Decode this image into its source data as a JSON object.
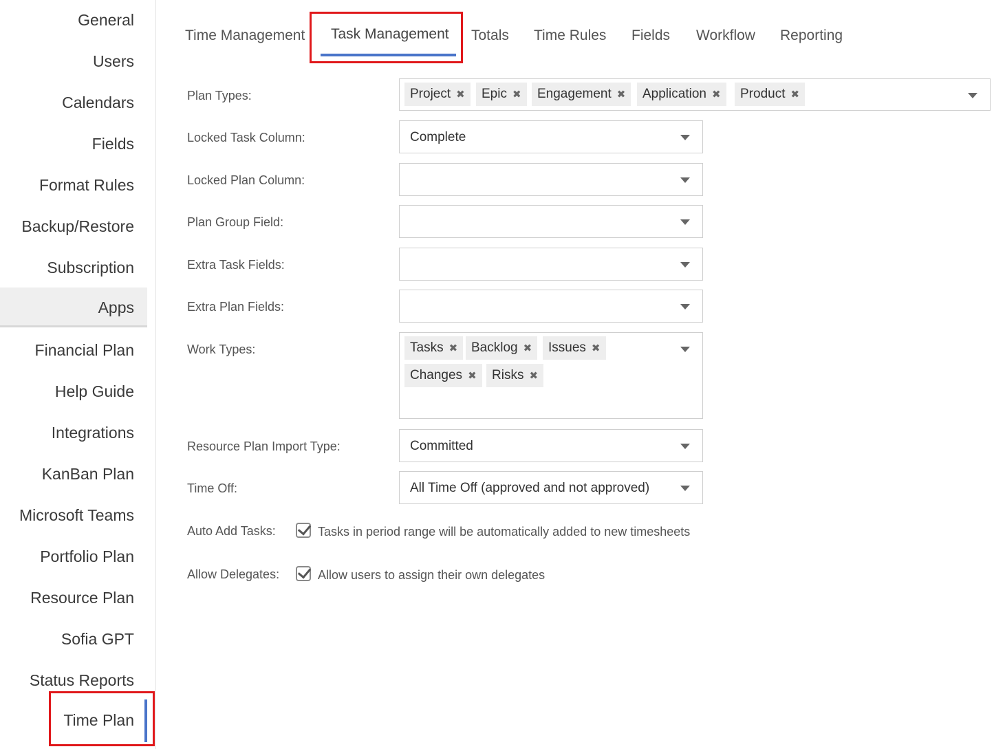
{
  "sidebar": {
    "items": [
      {
        "label": "General"
      },
      {
        "label": "Users"
      },
      {
        "label": "Calendars"
      },
      {
        "label": "Fields"
      },
      {
        "label": "Format Rules"
      },
      {
        "label": "Backup/Restore"
      },
      {
        "label": "Subscription"
      },
      {
        "label": "Apps"
      },
      {
        "label": "Financial Plan"
      },
      {
        "label": "Help Guide"
      },
      {
        "label": "Integrations"
      },
      {
        "label": "KanBan Plan"
      },
      {
        "label": "Microsoft Teams"
      },
      {
        "label": "Portfolio Plan"
      },
      {
        "label": "Resource Plan"
      },
      {
        "label": "Sofia GPT"
      },
      {
        "label": "Status Reports"
      },
      {
        "label": "Time Plan"
      }
    ],
    "active": "Time Plan"
  },
  "tabs": [
    {
      "label": "Time Management"
    },
    {
      "label": "Task Management"
    },
    {
      "label": "Totals"
    },
    {
      "label": "Time Rules"
    },
    {
      "label": "Fields"
    },
    {
      "label": "Workflow"
    },
    {
      "label": "Reporting"
    }
  ],
  "active_tab": "Task Management",
  "form": {
    "plan_types": {
      "label": "Plan Types:",
      "chips": [
        "Project",
        "Epic",
        "Engagement",
        "Application",
        "Product"
      ]
    },
    "locked_task_column": {
      "label": "Locked Task Column:",
      "value": "Complete"
    },
    "locked_plan_column": {
      "label": "Locked Plan Column:",
      "value": ""
    },
    "plan_group_field": {
      "label": "Plan Group Field:",
      "value": ""
    },
    "extra_task_fields": {
      "label": "Extra Task Fields:",
      "value": ""
    },
    "extra_plan_fields": {
      "label": "Extra Plan Fields:",
      "value": ""
    },
    "work_types": {
      "label": "Work Types:",
      "chips": [
        "Tasks",
        "Backlog",
        "Issues",
        "Changes",
        "Risks"
      ]
    },
    "resource_plan_import_type": {
      "label": "Resource Plan Import Type:",
      "value": "Committed"
    },
    "time_off": {
      "label": "Time Off:",
      "value": "All Time Off (approved and not approved)"
    },
    "auto_add_tasks": {
      "label": "Auto Add Tasks:",
      "checked": true,
      "text": "Tasks in period range will be automatically added to new timesheets"
    },
    "allow_delegates": {
      "label": "Allow Delegates:",
      "checked": true,
      "text": "Allow users to assign their own delegates"
    }
  },
  "chip_remove_glyph": "✖",
  "colors": {
    "accent": "#4a74c9",
    "highlight": "#e0181b",
    "chip_bg": "#eeeeee"
  }
}
